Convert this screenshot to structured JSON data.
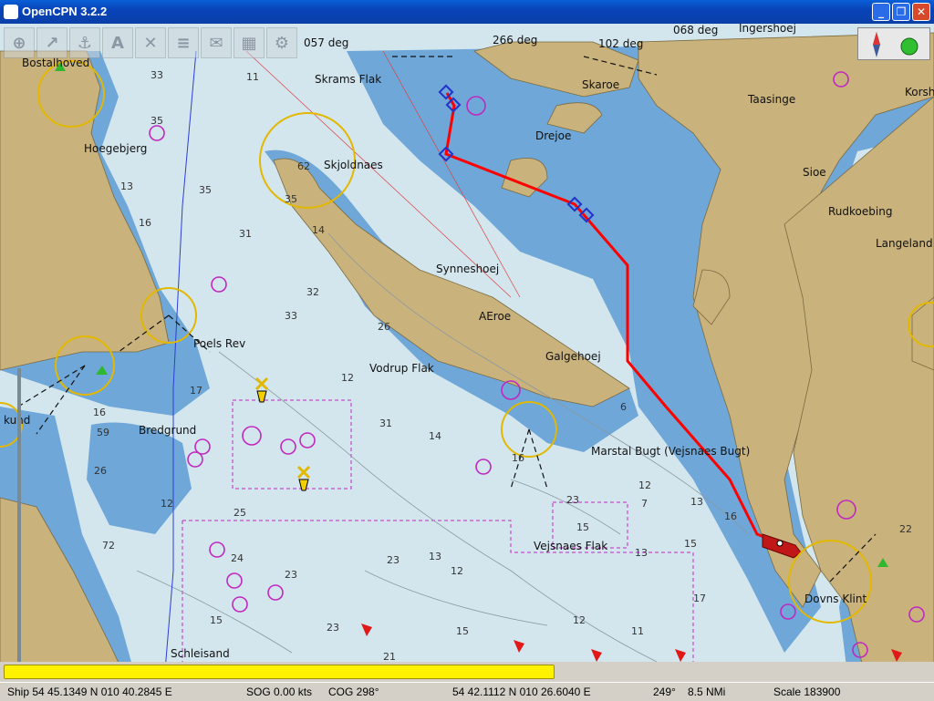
{
  "window": {
    "title": "OpenCPN 3.2.2"
  },
  "toolbar": {
    "tools": [
      "zoom-in-icon",
      "route-icon",
      "anchor-icon",
      "text-icon",
      "cross-icon",
      "layers-icon",
      "envelope-icon",
      "grid-icon",
      "settings-icon"
    ]
  },
  "colors": {
    "land": "#c9b27c",
    "shallow": "#6ea7d8",
    "water": "#d3e6ee",
    "route": "#ff0000",
    "progress": "#fff200"
  },
  "map_labels": {
    "skrams_flak": "Skrams Flak",
    "skjoldnaes": "Skjoldnaes",
    "hoegebjerg": "Hoegebjerg",
    "synneshoej": "Synneshoej",
    "aeroe": "AEroe",
    "galgehoej": "Galgehoej",
    "drejoe": "Drejoe",
    "skaroe": "Skaroe",
    "taasinge": "Taasinge",
    "sioe": "Sioe",
    "rudkoebing": "Rudkoebing",
    "langeland": "Langeland",
    "ingershoej": "Ingershoej",
    "korsh": "Korsh",
    "poels_rev": "Poels Rev",
    "vodrup_flak": "Vodrup Flak",
    "bredgrund": "Bredgrund",
    "marstal_bugt": "Marstal Bugt (Vejsnaes Bugt)",
    "vejsnaes_flak": "Vejsnaes Flak",
    "dovns_klint": "Dovns Klint",
    "schleisand": "Schleisand",
    "kund": "kund",
    "bostalhoved": "Bostalhoved",
    "deg_266": "266 deg",
    "deg_102": "102 deg",
    "deg_068": "068 deg",
    "deg_057": "057 deg"
  },
  "depths": [
    "33",
    "35",
    "11",
    "13",
    "16",
    "35",
    "31",
    "14",
    "32",
    "33",
    "26",
    "12",
    "17",
    "16",
    "59",
    "26",
    "31",
    "14",
    "16",
    "23",
    "15",
    "13",
    "12",
    "16",
    "15",
    "13",
    "12",
    "6",
    "7",
    "72",
    "24",
    "25",
    "23",
    "15",
    "23",
    "12",
    "17",
    "12",
    "11",
    "21",
    "23",
    "15",
    "22",
    "35",
    "62",
    "13"
  ],
  "status": {
    "ship": "Ship 54 45.1349 N   010 40.2845 E",
    "sog": "SOG 0.00 kts",
    "cog": "COG 298°",
    "cursor": "54 42.1112 N   010 26.6040 E",
    "bearing": "249°",
    "distance": "8.5 NMi",
    "scale": "Scale 183900"
  },
  "progress": {
    "fraction": 0.59
  }
}
